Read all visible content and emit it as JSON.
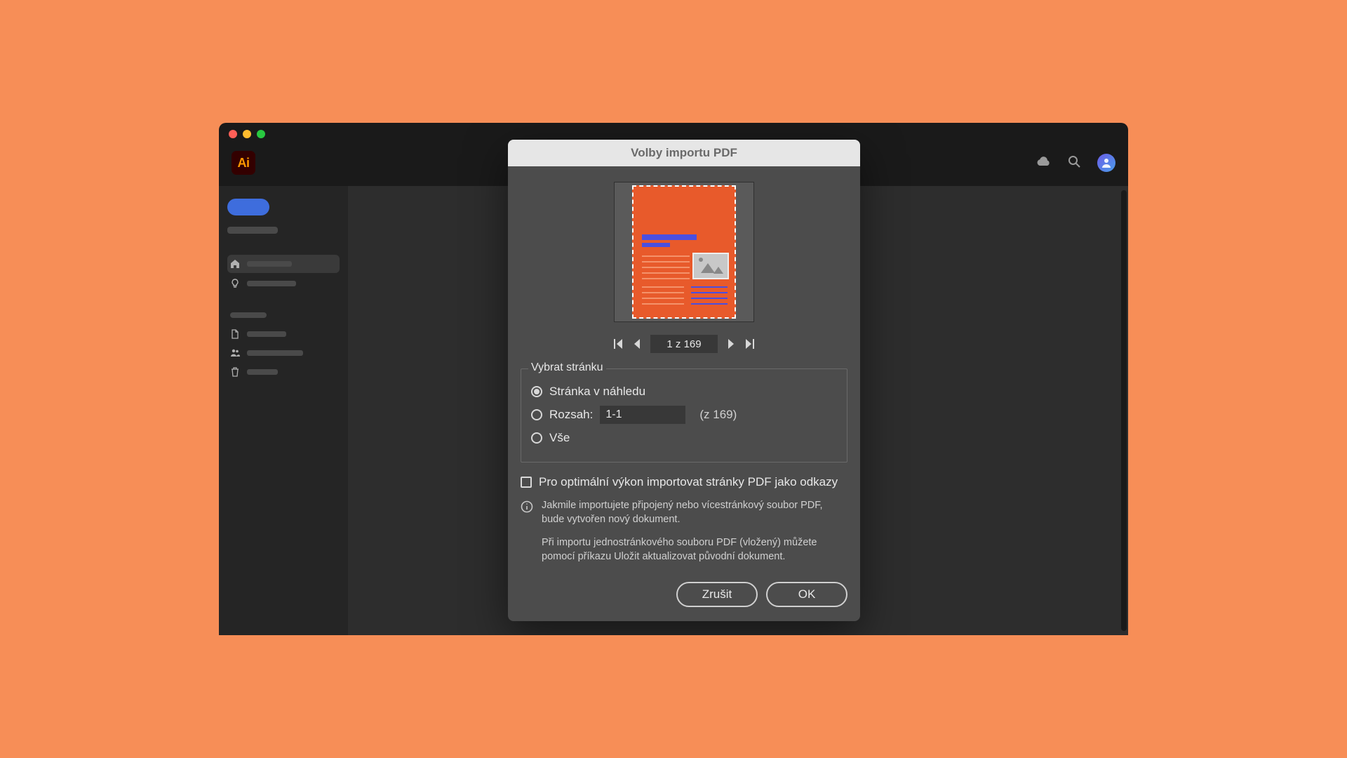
{
  "app": {
    "logo_text": "Ai"
  },
  "dialog": {
    "title": "Volby importu PDF",
    "pager": {
      "value": "1 z 169"
    },
    "fieldset": {
      "legend": "Vybrat stránku",
      "opt_preview": "Stránka v náhledu",
      "opt_range_label": "Rozsah:",
      "opt_range_value": "1-1",
      "range_total": "(z 169)",
      "opt_all": "Vše"
    },
    "checkbox_label": "Pro optimální výkon importovat stránky PDF jako odkazy",
    "info1": "Jakmile importujete připojený nebo vícestránkový soubor PDF, bude vytvořen nový dokument.",
    "info2": "Při importu jednostránkového souboru PDF (vložený) můžete pomocí příkazu Uložit aktualizovat původní dokument.",
    "cancel": "Zrušit",
    "ok": "OK"
  }
}
